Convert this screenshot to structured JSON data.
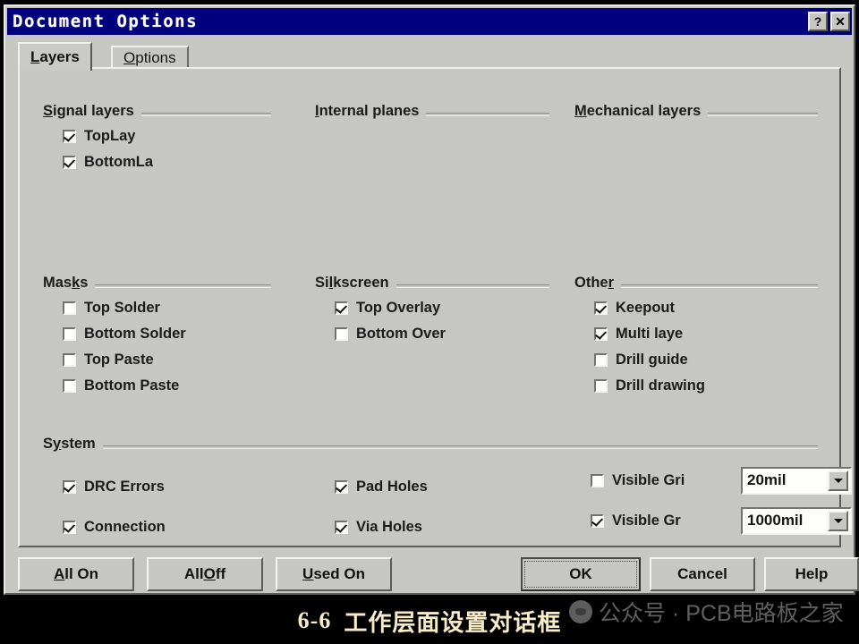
{
  "window": {
    "title": "Document Options",
    "help_button": "?",
    "close_button": "✕",
    "titlebar_color": "#00007e",
    "face_color": "#c6c6c3"
  },
  "tabs": [
    {
      "label": "Layers",
      "mnemonic": "L",
      "active": true
    },
    {
      "label": "Options",
      "mnemonic": "O",
      "active": false
    }
  ],
  "groups": {
    "signal_layers": {
      "title": "Signal layers",
      "mnemonic": "S",
      "items": [
        {
          "label": "TopLay",
          "checked": true
        },
        {
          "label": "BottomLa",
          "checked": true
        }
      ]
    },
    "internal_planes": {
      "title": "Internal planes",
      "mnemonic": "I",
      "items": []
    },
    "mechanical_layers": {
      "title": "Mechanical layers",
      "mnemonic": "M",
      "items": []
    },
    "masks": {
      "title": "Masks",
      "mnemonic": "k",
      "items": [
        {
          "label": "Top Solder",
          "checked": false
        },
        {
          "label": "Bottom Solder",
          "checked": false
        },
        {
          "label": "Top Paste",
          "checked": false
        },
        {
          "label": "Bottom Paste",
          "checked": false
        }
      ]
    },
    "silkscreen": {
      "title": "Silkscreen",
      "mnemonic": "l",
      "items": [
        {
          "label": "Top Overlay",
          "checked": true
        },
        {
          "label": "Bottom Over",
          "checked": false
        }
      ]
    },
    "other": {
      "title": "Other",
      "mnemonic": "r",
      "items": [
        {
          "label": "Keepout",
          "checked": true
        },
        {
          "label": "Multi laye",
          "checked": true
        },
        {
          "label": "Drill guide",
          "checked": false
        },
        {
          "label": "Drill drawing",
          "checked": false
        }
      ]
    },
    "system": {
      "title": "System",
      "mnemonic": "y",
      "col1": [
        {
          "label": "DRC Errors",
          "checked": true
        },
        {
          "label": "Connection",
          "checked": true
        }
      ],
      "col2": [
        {
          "label": "Pad Holes",
          "checked": true
        },
        {
          "label": "Via Holes",
          "checked": true
        }
      ],
      "col3": [
        {
          "label": "Visible Gri",
          "checked": false,
          "value": "20mil"
        },
        {
          "label": "Visible Gr",
          "checked": true,
          "value": "1000mil"
        }
      ]
    }
  },
  "buttons": {
    "all_on": {
      "label": "All On",
      "mnemonic": "A"
    },
    "all_off": {
      "label": "All Off",
      "mnemonic": "O"
    },
    "used_on": {
      "label": "Used On",
      "mnemonic": "U"
    },
    "ok": {
      "label": "OK",
      "default": true
    },
    "cancel": {
      "label": "Cancel"
    },
    "help": {
      "label": "Help"
    }
  },
  "caption": {
    "number": "6-6",
    "text": "工作层面设置对话框"
  },
  "watermark": {
    "text": "公众号 · PCB电路板之家"
  }
}
